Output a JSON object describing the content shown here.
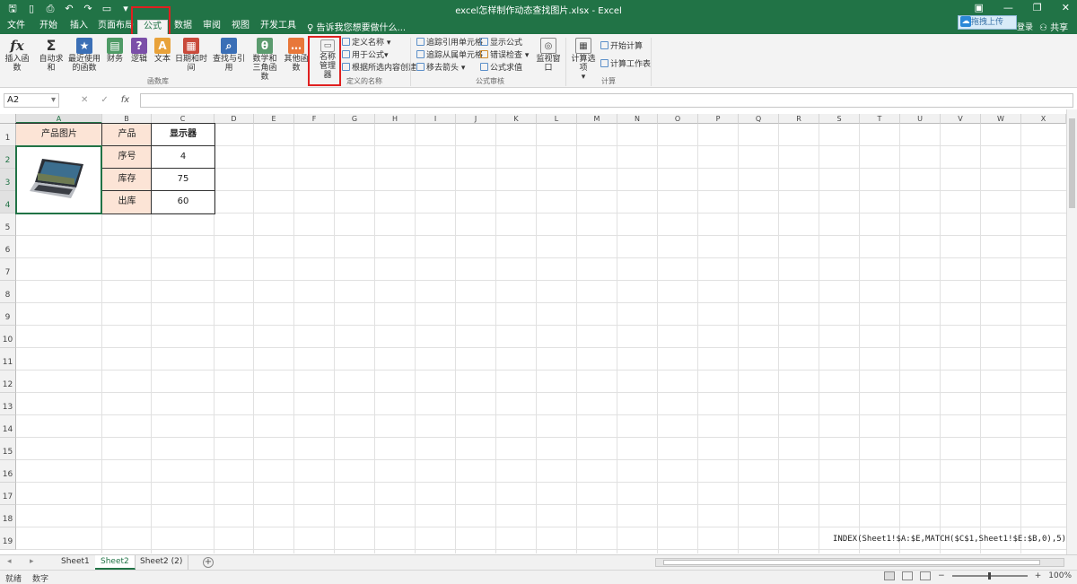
{
  "window": {
    "title": "excel怎样制作动态查找图片.xlsx - Excel",
    "controls": [
      "▣",
      "—",
      "❐",
      "✕"
    ]
  },
  "qat": {
    "icons": [
      "save-icon",
      "new-icon",
      "print-preview-icon",
      "undo-icon",
      "redo-icon",
      "open-icon",
      "customize-icon"
    ]
  },
  "tabs": [
    "文件",
    "开始",
    "插入",
    "页面布局",
    "公式",
    "数据",
    "审阅",
    "视图",
    "开发工具"
  ],
  "active_tab": "公式",
  "tell_me": "告诉我您想要做什么...",
  "account": {
    "upload": "拖拽上传",
    "login": "登录",
    "share": "共享"
  },
  "ribbon": {
    "function_library": {
      "label": "函数库",
      "buttons": [
        {
          "label": "插入函数",
          "icon": "fx-icon",
          "glyph": "fx",
          "color": "#f3f3f3"
        },
        {
          "label": "自动求和",
          "icon": "sum-icon",
          "glyph": "Σ",
          "color": "#f3f3f3"
        },
        {
          "label": "最近使用的函数",
          "icon": "star-icon",
          "glyph": "★",
          "color": "#3b6fb6"
        },
        {
          "label": "财务",
          "icon": "finance-icon",
          "glyph": "▤",
          "color": "#4f9b66"
        },
        {
          "label": "逻辑",
          "icon": "logic-icon",
          "glyph": "?",
          "color": "#7b4fa8"
        },
        {
          "label": "文本",
          "icon": "text-icon",
          "glyph": "A",
          "color": "#e8a23a"
        },
        {
          "label": "日期和时间",
          "icon": "datetime-icon",
          "glyph": "▦",
          "color": "#c94a3b"
        },
        {
          "label": "查找与引用",
          "icon": "lookup-icon",
          "glyph": "⌕",
          "color": "#3b6fb6"
        },
        {
          "label": "数学和三角函数",
          "icon": "math-icon",
          "glyph": "θ",
          "color": "#5b9b6e"
        },
        {
          "label": "其他函数",
          "icon": "more-functions-icon",
          "glyph": "…",
          "color": "#e8773a"
        }
      ]
    },
    "defined_names": {
      "label": "定义的名称",
      "name_manager": "名称管理器",
      "items": [
        "定义名称",
        "用于公式",
        "根据所选内容创建"
      ]
    },
    "formula_auditing": {
      "label": "公式审核",
      "items": [
        "追踪引用单元格",
        "追踪从属单元格",
        "移去箭头",
        "显示公式",
        "错误检查",
        "公式求值"
      ],
      "watch_window": "监视窗口"
    },
    "calculation": {
      "label": "计算",
      "options": "计算选项",
      "items": [
        "开始计算",
        "计算工作表"
      ]
    }
  },
  "formula_bar": {
    "name_box": "A2",
    "cancel": "✕",
    "enter": "✓",
    "fx": "fx",
    "value": ""
  },
  "columns": [
    "A",
    "B",
    "C",
    "D",
    "E",
    "F",
    "G",
    "H",
    "I",
    "J",
    "K",
    "L",
    "M",
    "N",
    "O",
    "P",
    "Q",
    "R",
    "S",
    "T",
    "U",
    "V",
    "W",
    "X"
  ],
  "rows": [
    "1",
    "2",
    "3",
    "4",
    "5",
    "6",
    "7",
    "8",
    "9",
    "10",
    "11",
    "12",
    "13",
    "14",
    "15",
    "16",
    "17",
    "18",
    "19"
  ],
  "cells": {
    "a1": "产品图片",
    "b1": "产品",
    "c1": "显示器",
    "b2": "序号",
    "c2": "4",
    "b3": "库存",
    "c3": "75",
    "b4": "出库",
    "c4": "60"
  },
  "formula_note": "INDEX(Sheet1!$A:$E,MATCH($C$1,Sheet1!$E:$B,0),5)",
  "sheets": [
    "Sheet1",
    "Sheet2",
    "Sheet2 (2)"
  ],
  "active_sheet": "Sheet2",
  "status": {
    "ready": "就绪",
    "mode": "数字",
    "zoom": "100%"
  },
  "colors": {
    "brand": "#217346",
    "header_fill": "#fce4d6",
    "highlight": "#e02020"
  }
}
